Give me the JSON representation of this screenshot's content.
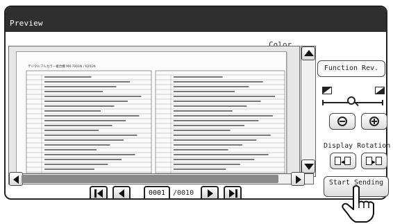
{
  "window": {
    "title": "Preview"
  },
  "preview": {
    "color_mode": "Color"
  },
  "pagination": {
    "current_page": "0001",
    "total_pages": "/0010"
  },
  "side_panel": {
    "function_review_label": "Function Rev.",
    "display_rotation_label": "Display Rotation",
    "start_sending_label": "Start Sending"
  },
  "document_thumbnail": {
    "page_title": "デジタルフルカラー複合機 MX-7001N / 6201N"
  },
  "icons": [
    "first-page-icon",
    "prev-page-icon",
    "next-page-icon",
    "last-page-icon",
    "scroll-up-icon",
    "scroll-down-icon",
    "scroll-left-icon",
    "scroll-right-icon",
    "zoom-out-icon",
    "zoom-in-icon",
    "magnifier-icon",
    "rotate-left-icon",
    "rotate-right-icon",
    "pointing-hand-icon"
  ]
}
